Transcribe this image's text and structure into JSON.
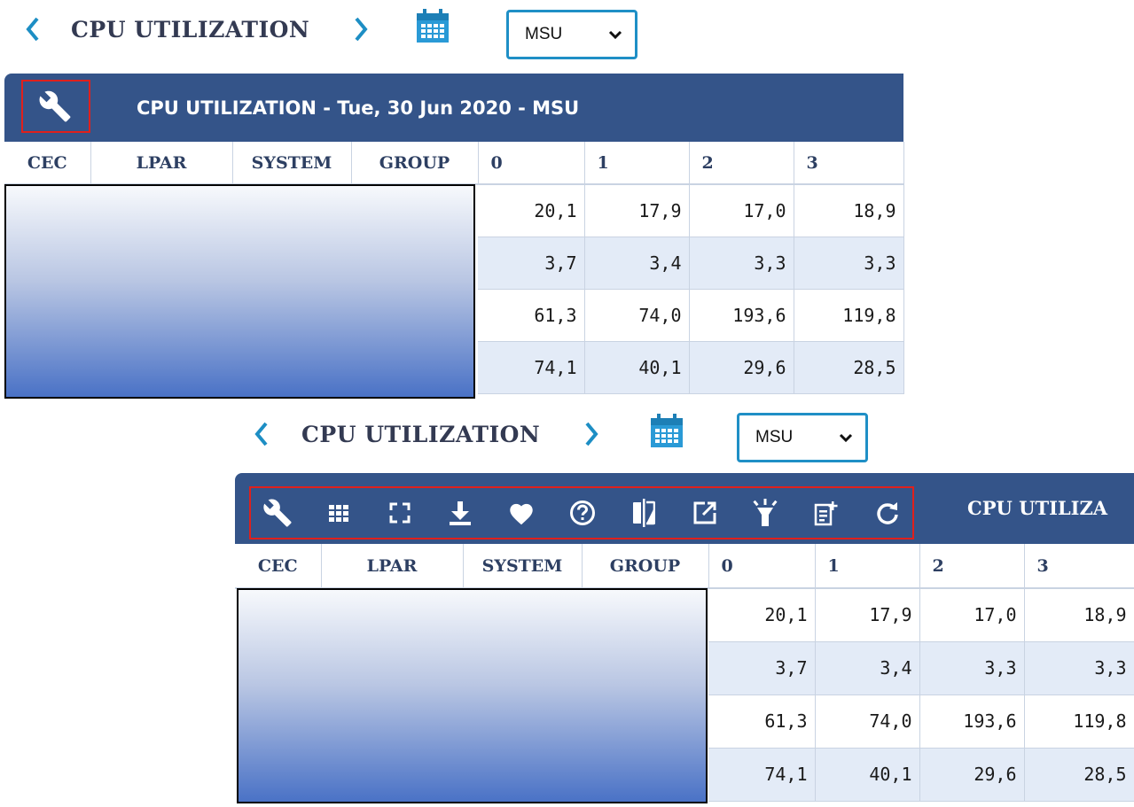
{
  "top": {
    "prev_label": "<",
    "title": "CPU UTILIZATION",
    "next_label": ">",
    "unit_select": "MSU"
  },
  "panel1": {
    "header_title": "CPU UTILIZATION - Tue, 30 Jun 2020 - MSU"
  },
  "bottom": {
    "prev_label": "<",
    "title": "CPU UTILIZATION",
    "next_label": ">",
    "unit_select": "MSU",
    "header_title_truncated": "CPU UTILIZA"
  },
  "table": {
    "columns": [
      "CEC",
      "LPAR",
      "SYSTEM",
      "GROUP",
      "0",
      "1",
      "2",
      "3"
    ],
    "rows": [
      [
        "20,1",
        "17,9",
        "17,0",
        "18,9"
      ],
      [
        "3,7",
        "3,4",
        "3,3",
        "3,3"
      ],
      [
        "61,3",
        "74,0",
        "193,6",
        "119,8"
      ],
      [
        "74,1",
        "40,1",
        "29,6",
        "28,5"
      ]
    ]
  },
  "toolbar_icons": [
    "wrench-icon",
    "grid-icon",
    "fullscreen-icon",
    "download-icon",
    "favorite-heart-icon",
    "help-icon",
    "compare-icon",
    "open-external-icon",
    "highlight-icon",
    "add-note-icon",
    "refresh-icon"
  ],
  "colors": {
    "header_bg": "#345489",
    "accent": "#1d8ec4",
    "alt_row": "#e3ebf7",
    "highlight_box": "#e0201c"
  }
}
